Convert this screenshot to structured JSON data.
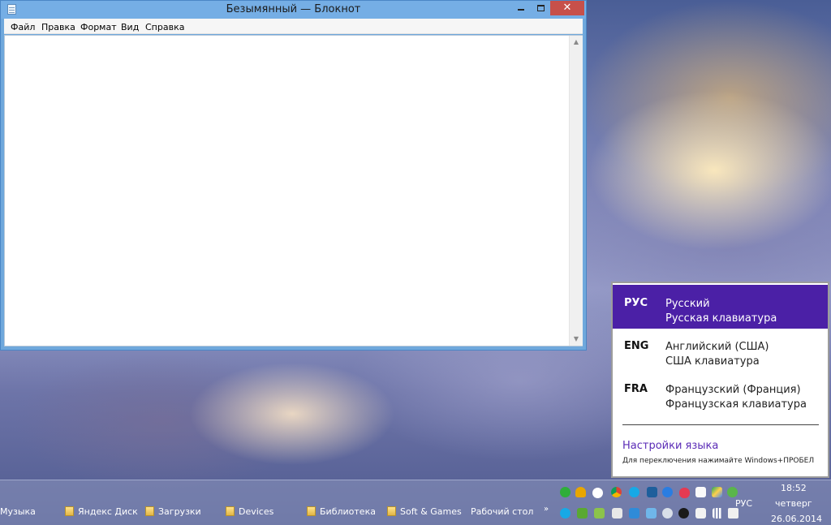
{
  "notepad": {
    "title": "Безымянный — Блокнот",
    "close_glyph": "✕",
    "menu": [
      "Файл",
      "Правка",
      "Формат",
      "Вид",
      "Справка"
    ],
    "content": ""
  },
  "language_popup": {
    "items": [
      {
        "code": "РУС",
        "name": "Русский",
        "keyboard": "Русская клавиатура",
        "active": true
      },
      {
        "code": "ENG",
        "name": "Английский (США)",
        "keyboard": "США клавиатура",
        "active": false
      },
      {
        "code": "FRA",
        "name": "Французский (Франция)",
        "keyboard": "Французская клавиатура",
        "active": false
      }
    ],
    "settings_link": "Настройки языка",
    "hint": "Для переключения нажимайте Windows+ПРОБЕЛ",
    "active_color": "#4b20a6"
  },
  "taskbar": {
    "toolbar_items": [
      "Музыка",
      "Яндекс Диск",
      "Загрузки",
      "Devices",
      "Библиотека",
      "Soft & Games",
      "Рабочий стол"
    ],
    "chevron": "»",
    "language": "РУС",
    "clock": {
      "time": "18:52",
      "day": "четверг",
      "date": "26.06.2014"
    },
    "tray_icons_top": [
      "green-circle-icon",
      "yandex-disk-icon",
      "onedrive-cloud-icon",
      "chrome-icon",
      "skype-icon",
      "network-adapter-icon",
      "teamviewer-icon",
      "lips-icon",
      "white-square-icon",
      "google-drive-icon",
      "sync-icon"
    ],
    "tray_icons_bottom": [
      "skype-tray-icon",
      "utorrent-icon",
      "checkmark-icon",
      "keyboard-icon",
      "calendar-icon",
      "window-icon",
      "bluetooth-icon",
      "bug-icon",
      "flag-icon",
      "signal-bars-icon",
      "volume-icon"
    ]
  }
}
